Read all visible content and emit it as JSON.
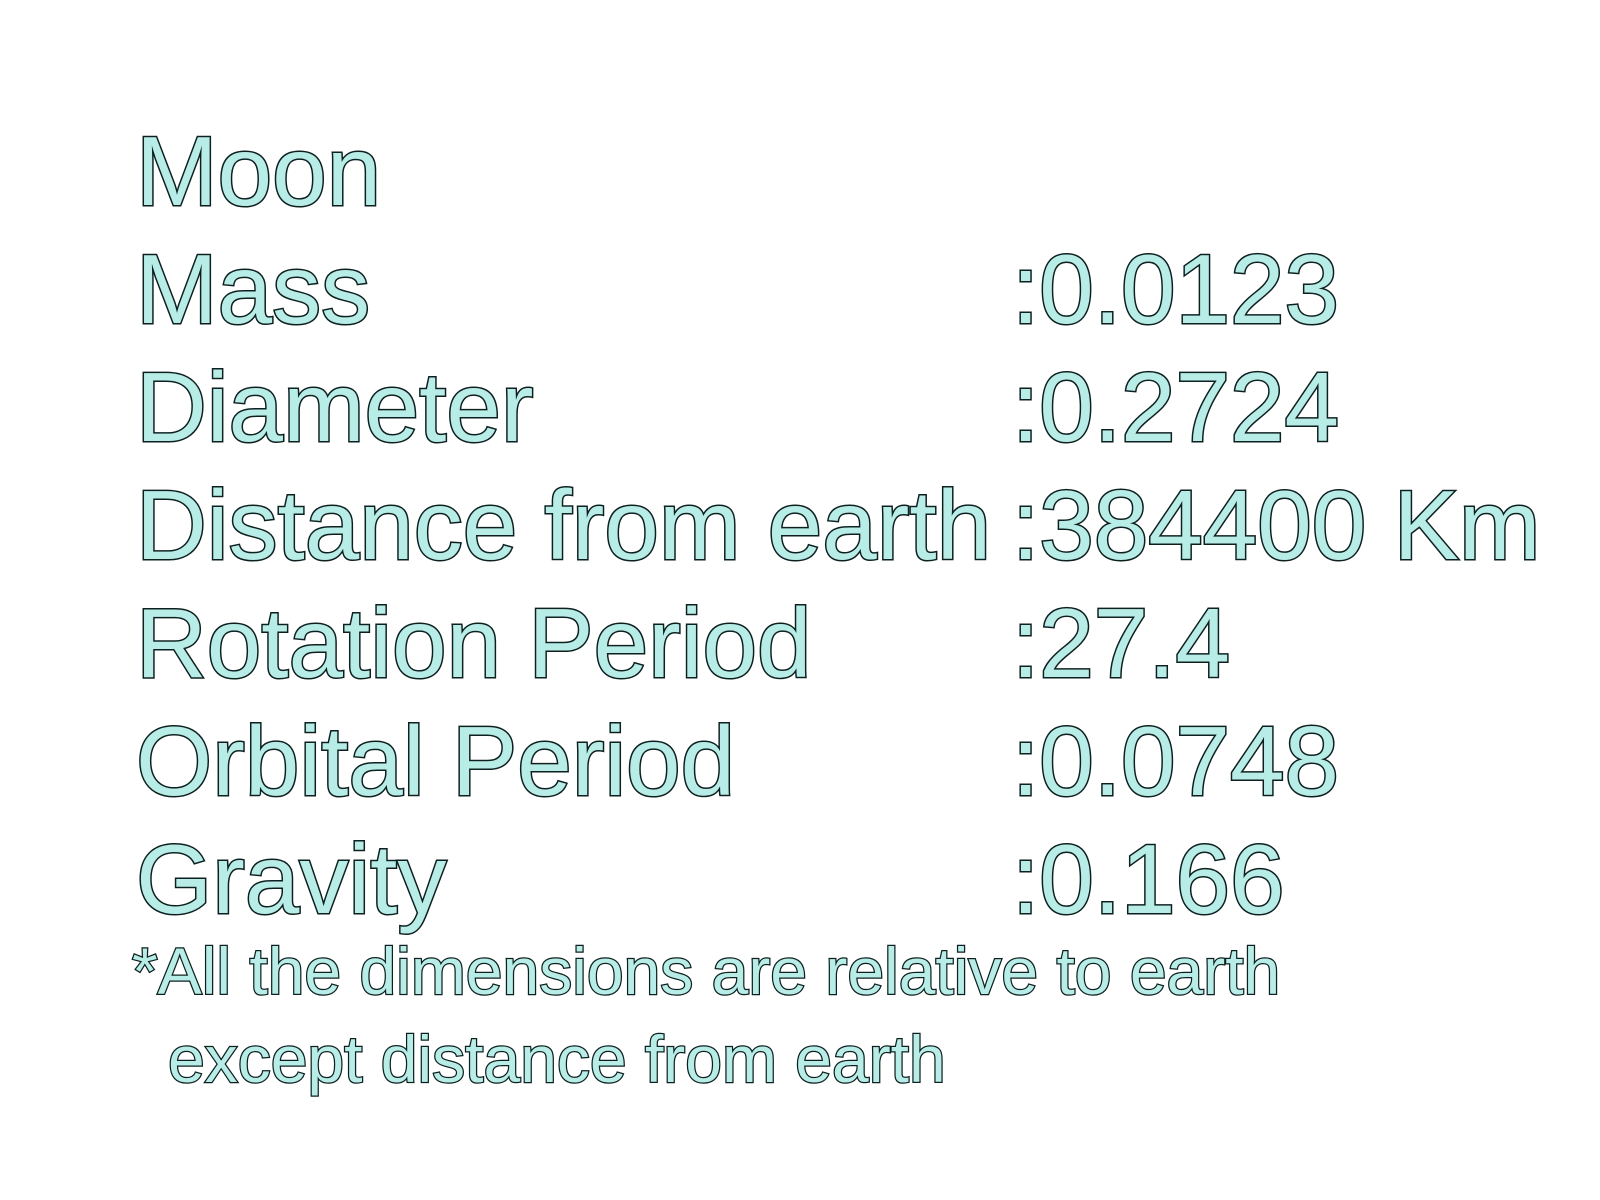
{
  "title": "Moon",
  "rows": [
    {
      "label": "Mass",
      "value": ":0.0123"
    },
    {
      "label": "Diameter",
      "value": ":0.2724"
    },
    {
      "label": "Distance from earth",
      "value": ":384400 Km"
    },
    {
      "label": "Rotation Period",
      "value": ":27.4"
    },
    {
      "label": "Orbital Period",
      "value": ":0.0748"
    },
    {
      "label": "Gravity",
      "value": ":0.166"
    }
  ],
  "footnote": {
    "line1": "*All the dimensions are relative to earth",
    "line2": "except distance from earth"
  },
  "colors": {
    "text_fill": "#b8ece6",
    "text_outline": "#0d1f1f",
    "background": "#ffffff"
  }
}
